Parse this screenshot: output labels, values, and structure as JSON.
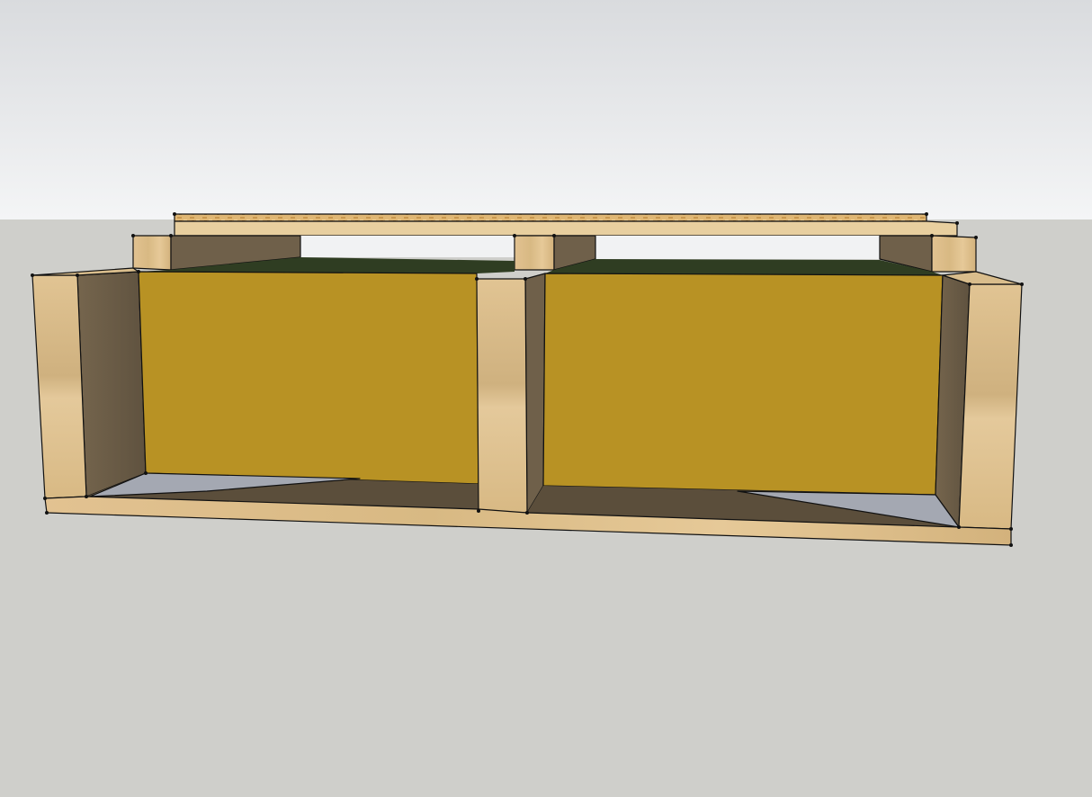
{
  "scene": {
    "colors": {
      "sky_top": "#dadcdf",
      "sky_bottom": "#f3f4f5",
      "ground": "#cfcfcb",
      "wood_light": "#e5c590",
      "wood_mid": "#d8b883",
      "wood_shadow": "#6c5c45",
      "wood_dark_side": "#7a6a52",
      "osb": "#d9b06a",
      "insulation": "#b89224",
      "insulation_top": "#2f3d22",
      "floor_shadow": "#4a3f31",
      "floor_reflection": "#9fa3ad",
      "edge": "#111111"
    }
  }
}
